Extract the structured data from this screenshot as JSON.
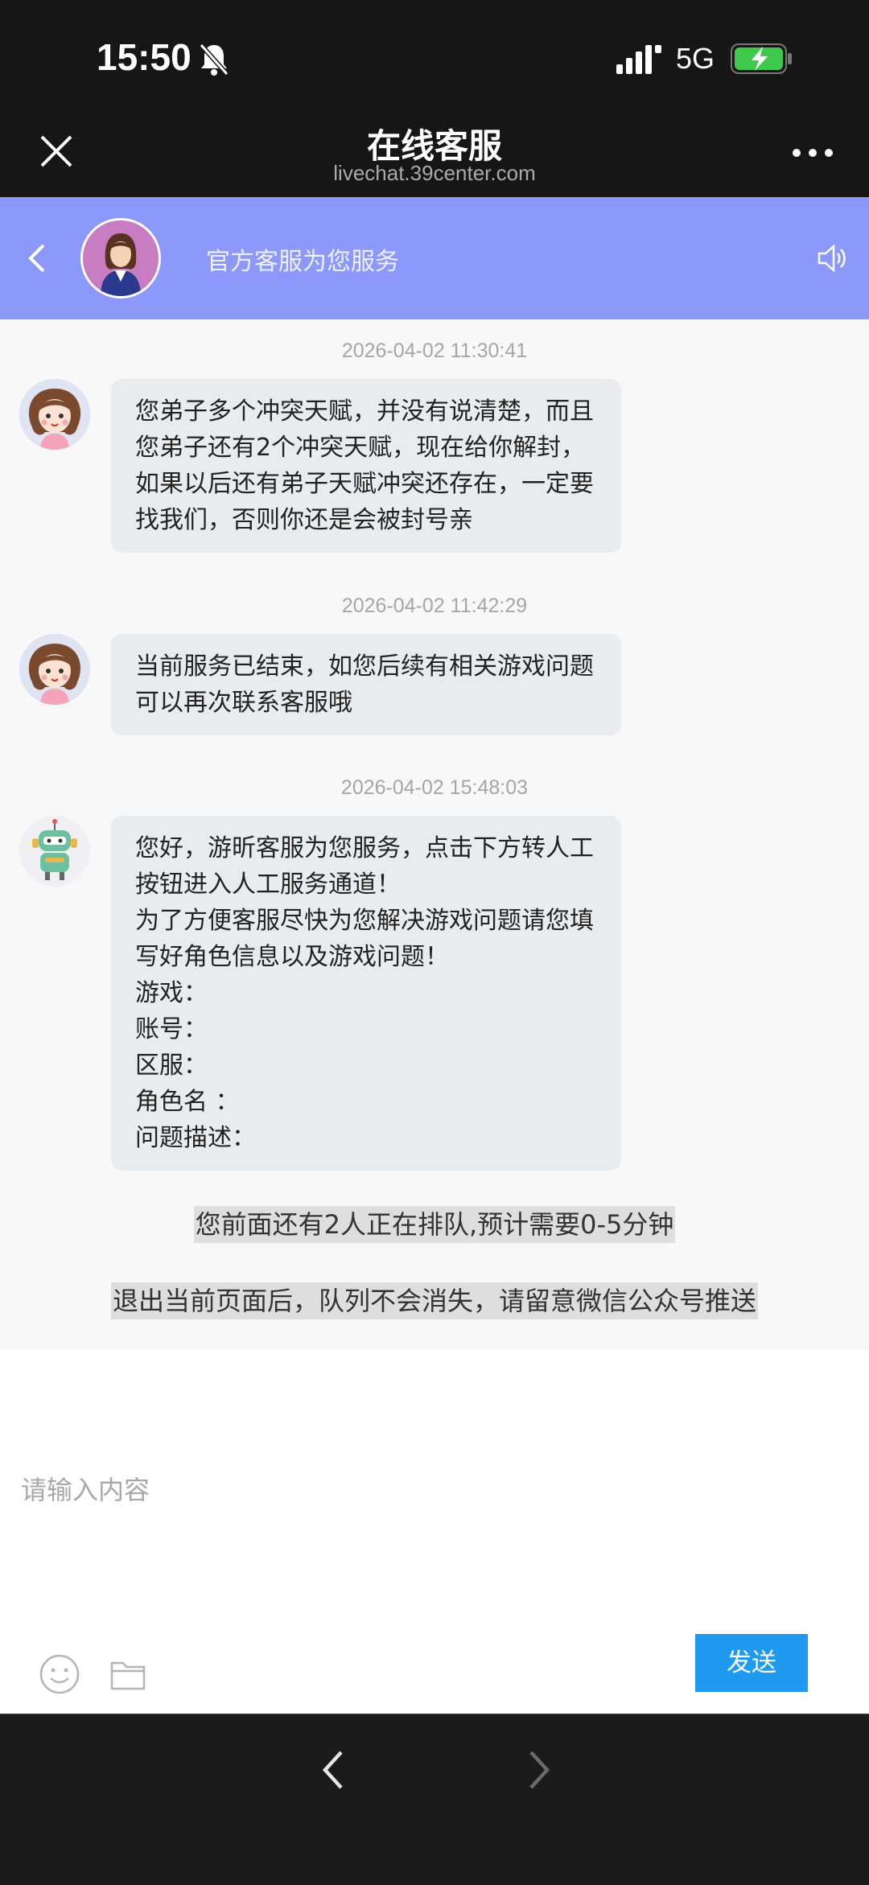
{
  "status_bar": {
    "time": "15:50",
    "network": "5G"
  },
  "nav": {
    "title": "在线客服",
    "subtitle": "livechat.39center.com"
  },
  "chat_header": {
    "text": "官方客服为您服务"
  },
  "messages": [
    {
      "timestamp": "2026-04-02 11:30:41",
      "sender": "agent",
      "lines": [
        "您弟子多个冲突天赋，并没有说清楚，而且",
        "您弟子还有2个冲突天赋，现在给你解封，",
        "如果以后还有弟子天赋冲突还存在，一定要",
        "找我们，否则你还是会被封号亲"
      ]
    },
    {
      "timestamp": "2026-04-02 11:42:29",
      "sender": "agent",
      "lines": [
        "当前服务已结束，如您后续有相关游戏问题",
        "可以再次联系客服哦"
      ]
    },
    {
      "timestamp": "2026-04-02 15:48:03",
      "sender": "robot",
      "lines": [
        "您好，游昕客服为您服务，点击下方转人工",
        "按钮进入人工服务通道！",
        "为了方便客服尽快为您解决游戏问题请您填",
        "写好角色信息以及游戏问题！",
        "游戏：",
        "账号：",
        "区服：",
        "角色名 ：",
        "问题描述："
      ]
    }
  ],
  "notices": {
    "queue": "您前面还有2人正在排队,预计需要0-5分钟",
    "exit_tip": "退出当前页面后，队列不会消失，请留意微信公众号推送"
  },
  "input": {
    "placeholder": "请输入内容",
    "send_label": "发送"
  },
  "colors": {
    "header_bg": "#8c99fb",
    "send_button": "#1e9bf0",
    "bubble_bg": "#e8ecef"
  }
}
